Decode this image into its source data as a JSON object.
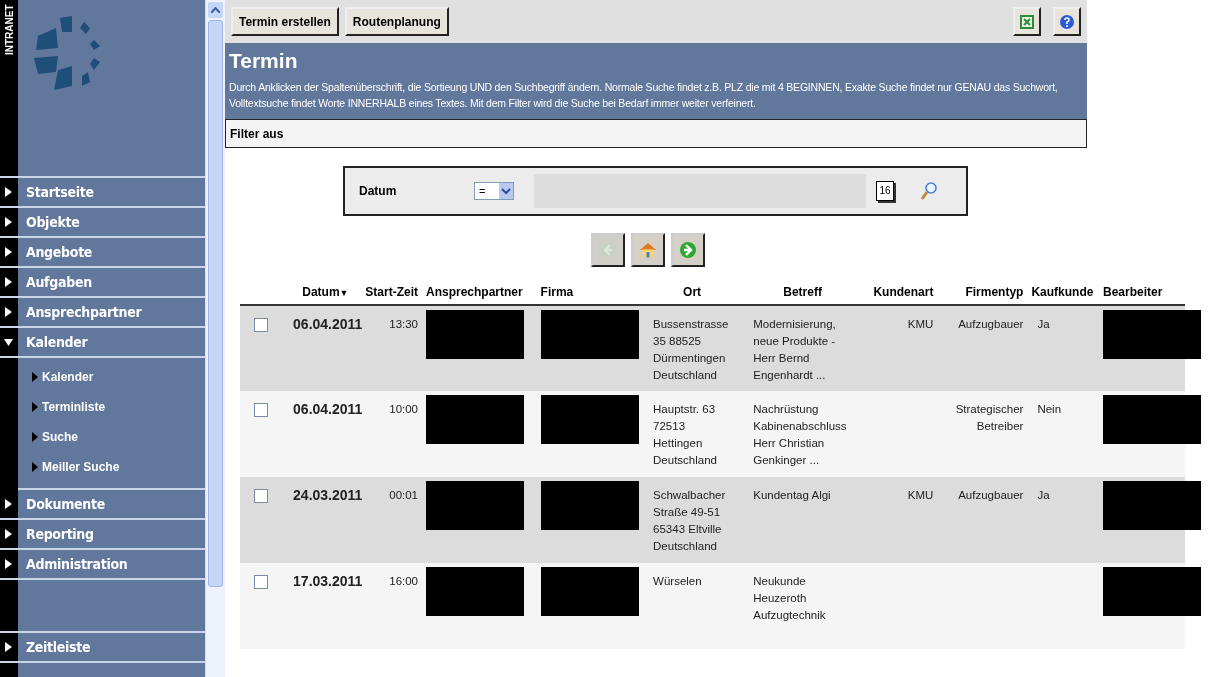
{
  "sidebar": {
    "brand": "INTRANET",
    "items": [
      {
        "label": "Startseite",
        "expanded": false
      },
      {
        "label": "Objekte",
        "expanded": false
      },
      {
        "label": "Angebote",
        "expanded": false
      },
      {
        "label": "Aufgaben",
        "expanded": false
      },
      {
        "label": "Ansprechpartner",
        "expanded": false
      },
      {
        "label": "Kalender",
        "expanded": true,
        "children": [
          {
            "label": "Kalender"
          },
          {
            "label": "Terminliste"
          },
          {
            "label": "Suche"
          },
          {
            "label": "Meiller Suche"
          }
        ]
      },
      {
        "label": "Dokumente",
        "expanded": false
      },
      {
        "label": "Reporting",
        "expanded": false
      },
      {
        "label": "Administration",
        "expanded": false
      }
    ],
    "footer_item": {
      "label": "Zeitleiste"
    }
  },
  "toolbar": {
    "buttons": [
      "Termin erstellen",
      "Routenplanung"
    ]
  },
  "header": {
    "title": "Termin",
    "description": "Durch Anklicken der Spaltenüberschrift, die Sortieung UND den Suchbegriff ändern. Normale Suche findet z.B. PLZ die mit 4 BEGINNEN, Exakte Suche findet nur GENAU das Suchwort, Volltextsuche findet Worte INNERHALB eines Textes. Mit dem Filter wird die Suche bei Bedarf immer weiter verfeinert."
  },
  "filter_bar": {
    "label": "Filter aus"
  },
  "filter": {
    "label": "Datum",
    "operator": "=",
    "calendar_day": "16"
  },
  "pager": [
    {
      "kind": "back",
      "disabled": true
    },
    {
      "kind": "home",
      "disabled": false
    },
    {
      "kind": "forward",
      "disabled": false
    }
  ],
  "table": {
    "columns": [
      {
        "label": "Datum",
        "sort_mark": "▼"
      },
      {
        "label": "Start-Zeit"
      },
      {
        "label": "Ansprechpartner"
      },
      {
        "label": "Firma"
      },
      {
        "label": "Ort"
      },
      {
        "label": "Betreff"
      },
      {
        "label": "Kundenart"
      },
      {
        "label": "Firmentyp"
      },
      {
        "label": "Kaufkunde"
      },
      {
        "label": "Bearbeiter"
      }
    ],
    "rows": [
      {
        "checked": false,
        "datum": "06.04.2011",
        "start_zeit": "13:30",
        "contact_redacted": true,
        "company_redacted": true,
        "ort": [
          "Bussenstrasse",
          "35 88525",
          "Dürmentingen",
          "Deutschland"
        ],
        "betreff": [
          "Modernisierung,",
          "neue Produkte -",
          "Herr Bernd",
          "Engenhardt ..."
        ],
        "kundenart": "KMU",
        "firmentyp": [
          "Aufzugbauer"
        ],
        "kaufkunde": "Ja",
        "editor_redacted": true
      },
      {
        "checked": false,
        "datum": "06.04.2011",
        "start_zeit": "10:00",
        "contact_redacted": true,
        "company_redacted": true,
        "ort": [
          "Hauptstr. 63",
          "72513",
          "Hettingen",
          "Deutschland"
        ],
        "betreff": [
          "Nachrüstung",
          "Kabinenabschluss",
          "Herr Christian",
          "Genkinger ..."
        ],
        "firmentyp": [
          "Strategischer",
          "Betreiber"
        ],
        "kaufkunde": "Nein",
        "editor_redacted": true
      },
      {
        "checked": false,
        "datum": "24.03.2011",
        "start_zeit": "00:01",
        "contact_redacted": true,
        "company_redacted": true,
        "ort": [
          "Schwalbacher",
          "Straße 49-51",
          "65343 Eltville",
          "Deutschland"
        ],
        "betreff": [
          "Kundentag Algi"
        ],
        "kundenart": "KMU",
        "firmentyp": [
          "Aufzugbauer"
        ],
        "kaufkunde": "Ja",
        "editor_redacted": true
      },
      {
        "checked": false,
        "datum": "17.03.2011",
        "start_zeit": "16:00",
        "contact_redacted": true,
        "company_redacted": true,
        "ort": [
          "Würselen"
        ],
        "betreff": [
          "Neukunde",
          "Heuzeroth",
          "Aufzugtechnik"
        ],
        "editor_redacted": true
      }
    ]
  }
}
